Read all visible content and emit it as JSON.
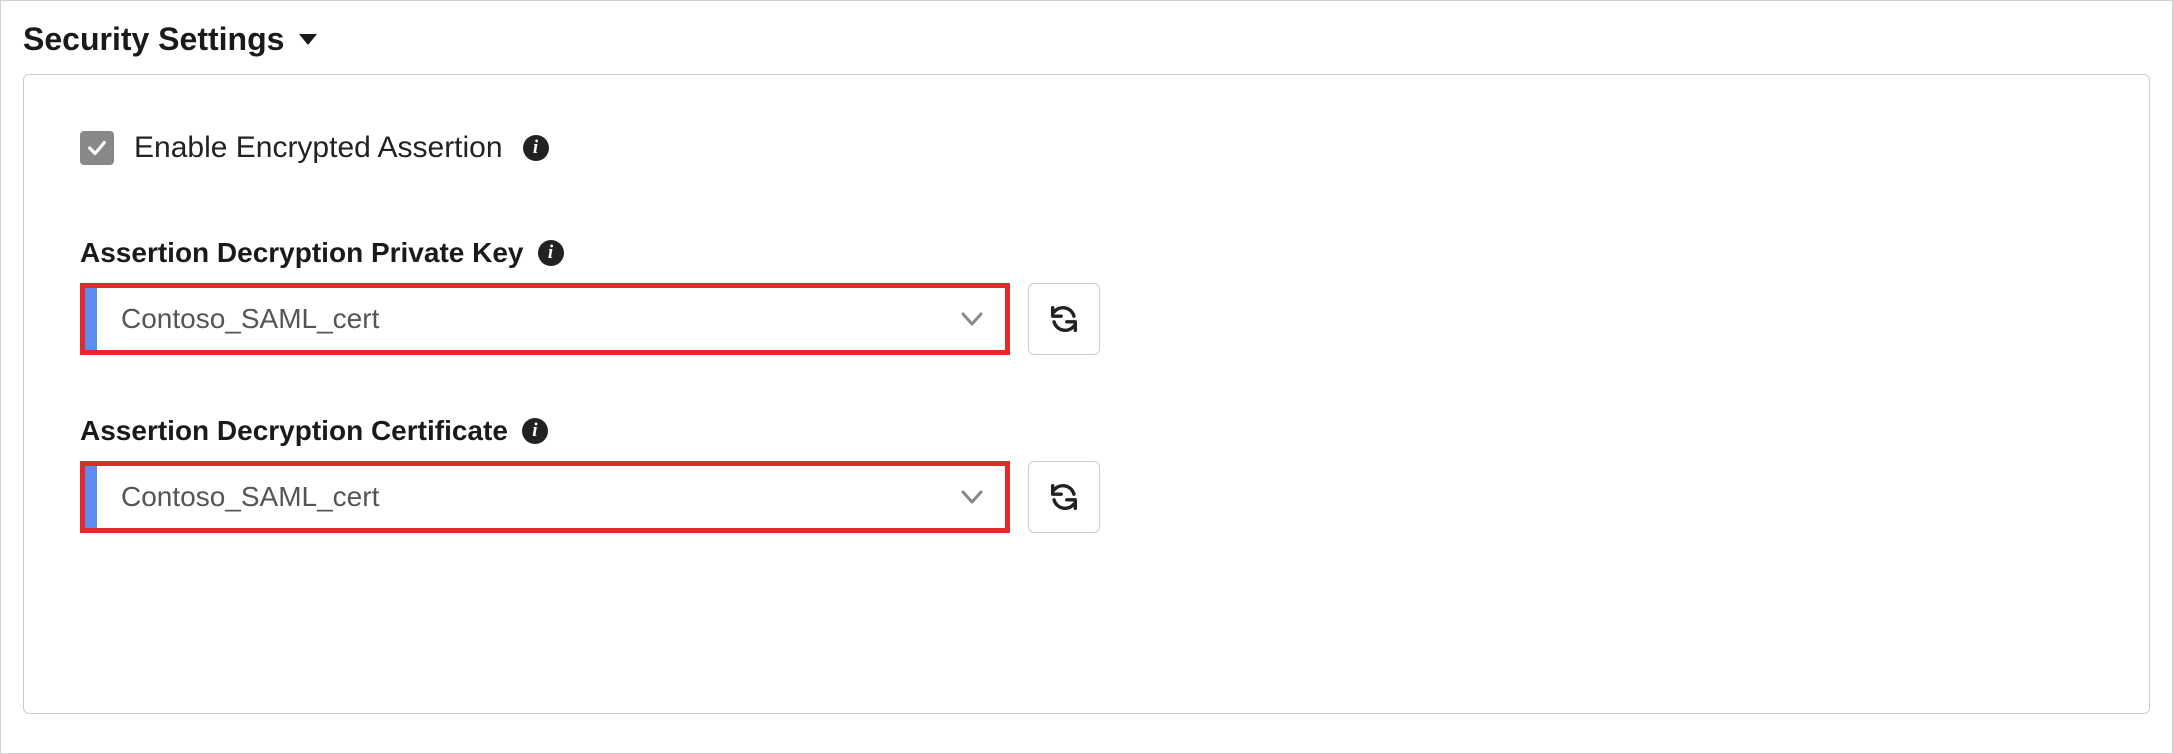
{
  "section": {
    "title": "Security Settings"
  },
  "enable_encrypted_assertion": {
    "label": "Enable Encrypted Assertion",
    "checked": true
  },
  "fields": {
    "private_key": {
      "label": "Assertion Decryption Private Key",
      "value": "Contoso_SAML_cert"
    },
    "certificate": {
      "label": "Assertion Decryption Certificate",
      "value": "Contoso_SAML_cert"
    }
  },
  "colors": {
    "highlight": "#e22a2a",
    "accent": "#5b8def",
    "checkbox": "#888888"
  }
}
